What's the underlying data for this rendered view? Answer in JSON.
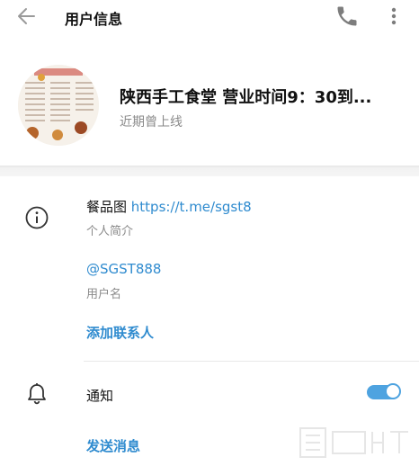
{
  "header": {
    "title": "用户信息",
    "back_icon": "arrow-left-icon",
    "call_icon": "phone-icon",
    "menu_icon": "more-vertical-icon"
  },
  "profile": {
    "name": "陕西手工食堂 营业时间9：30到...",
    "status": "近期曾上线",
    "avatar_icon": "menu-photo-avatar"
  },
  "info": {
    "bio_prefix": "餐品图 ",
    "bio_link": "https://t.me/sgst8",
    "bio_label": "个人简介",
    "username": "@SGST888",
    "username_label": "用户名",
    "add_contact": "添加联系人",
    "info_icon": "info-icon"
  },
  "notifications": {
    "label": "通知",
    "enabled": true,
    "bell_icon": "bell-icon"
  },
  "actions": {
    "send_message": "发送消息"
  },
  "colors": {
    "accent": "#2f8bcf",
    "toggle": "#4ea3e0",
    "muted_text": "#8a8a8a"
  }
}
